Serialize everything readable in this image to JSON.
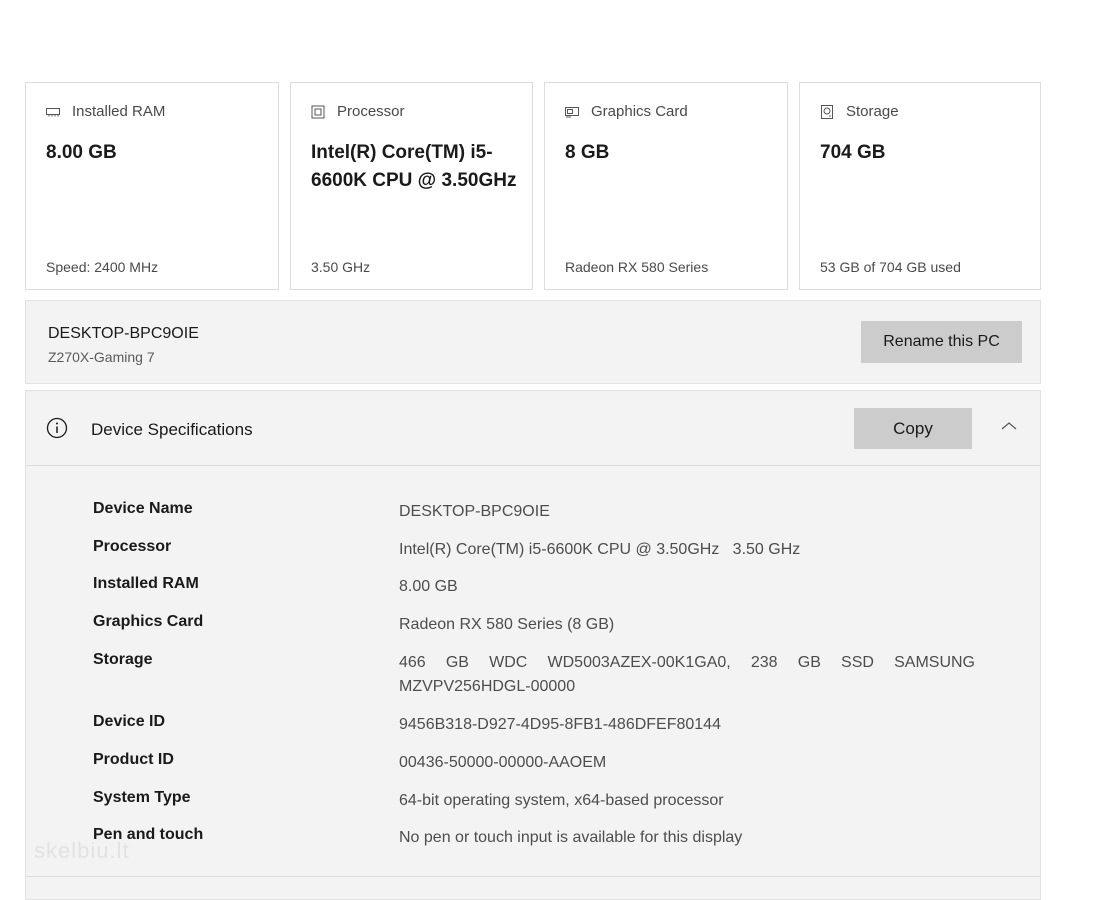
{
  "cards": [
    {
      "icon": "ram-icon",
      "title": "Installed RAM",
      "value": "8.00 GB",
      "sub": "Speed: 2400 MHz"
    },
    {
      "icon": "processor-icon",
      "title": "Processor",
      "value": "Intel(R) Core(TM) i5-6600K CPU @ 3.50GHz",
      "sub": "3.50 GHz"
    },
    {
      "icon": "graphics-card-icon",
      "title": "Graphics Card",
      "value": "8 GB",
      "sub": "Radeon RX 580 Series"
    },
    {
      "icon": "storage-icon",
      "title": "Storage",
      "value": "704 GB",
      "sub": "53 GB of 704 GB used"
    }
  ],
  "pc": {
    "name": "DESKTOP-BPC9OIE",
    "model": "Z270X-Gaming 7",
    "rename_label": "Rename this PC"
  },
  "specs": {
    "title": "Device Specifications",
    "copy_label": "Copy",
    "rows": [
      {
        "label": "Device Name",
        "value": "DESKTOP-BPC9OIE"
      },
      {
        "label": "Processor",
        "value": "Intel(R) Core(TM) i5-6600K CPU @ 3.50GHz   3.50 GHz"
      },
      {
        "label": "Installed RAM",
        "value": "8.00 GB"
      },
      {
        "label": "Graphics Card",
        "value": "Radeon RX 580 Series (8 GB)"
      },
      {
        "label": "Storage",
        "value": "466 GB WDC WD5003AZEX-00K1GA0, 238 GB SSD SAMSUNG MZVPV256HDGL-00000"
      },
      {
        "label": "Device ID",
        "value": "9456B318-D927-4D95-8FB1-486DFEF80144"
      },
      {
        "label": "Product ID",
        "value": "00436-50000-00000-AAOEM"
      },
      {
        "label": "System Type",
        "value": "64-bit operating system, x64-based processor"
      },
      {
        "label": "Pen and touch",
        "value": "No pen or touch input is available for this display"
      }
    ]
  },
  "watermark": "skelbiu.lt",
  "colors": {
    "panel_bg": "#f3f3f3",
    "button_bg": "#cccccc",
    "card_border": "#dcdcdc"
  }
}
